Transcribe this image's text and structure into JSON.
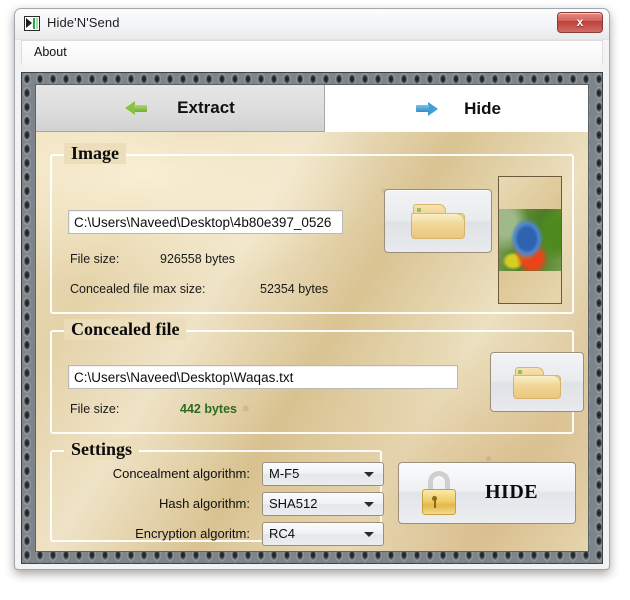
{
  "window": {
    "title": "Hide'N'Send",
    "app_icon": "app-logo-icon",
    "close_label": "x"
  },
  "menubar": {
    "items": [
      {
        "label": "About"
      }
    ]
  },
  "tabs": [
    {
      "id": "extract",
      "label": "Extract",
      "icon": "green-left-arrow-icon",
      "selected": false
    },
    {
      "id": "hide",
      "label": "Hide",
      "icon": "blue-right-arrow-icon",
      "selected": true
    }
  ],
  "image_group": {
    "title": "Image",
    "path_value": "C:\\Users\\Naveed\\Desktop\\4b80e397_0526",
    "path_placeholder": "Select an image file",
    "file_size_label": "File size:",
    "file_size_value": "926558 bytes",
    "max_size_label": "Concealed file max size:",
    "max_size_value": "52354 bytes",
    "browse_icon": "open-folder-icon",
    "preview_alt": "rainbow-lorikeet-preview"
  },
  "concealed_group": {
    "title": "Concealed file",
    "path_value": "C:\\Users\\Naveed\\Desktop\\Waqas.txt",
    "path_placeholder": "Select a file to conceal",
    "file_size_label": "File size:",
    "file_size_value": "442 bytes",
    "file_size_color": "#2f6b1f",
    "browse_icon": "open-folder-icon"
  },
  "settings_group": {
    "title": "Settings",
    "rows": [
      {
        "label": "Concealment algorithm:",
        "value": "M-F5"
      },
      {
        "label": "Hash algorithm:",
        "value": "SHA512"
      },
      {
        "label": "Encryption algoritm:",
        "value": "RC4"
      }
    ]
  },
  "action": {
    "hide_label": "HIDE",
    "hide_icon": "padlock-icon"
  },
  "colors": {
    "accent_green": "#2f6b1f",
    "close_red": "#bf3e37",
    "parchment": "#e4d2a8",
    "tab_selected_bg": "#ffffff",
    "tab_unselected_bg": "#dedede"
  }
}
